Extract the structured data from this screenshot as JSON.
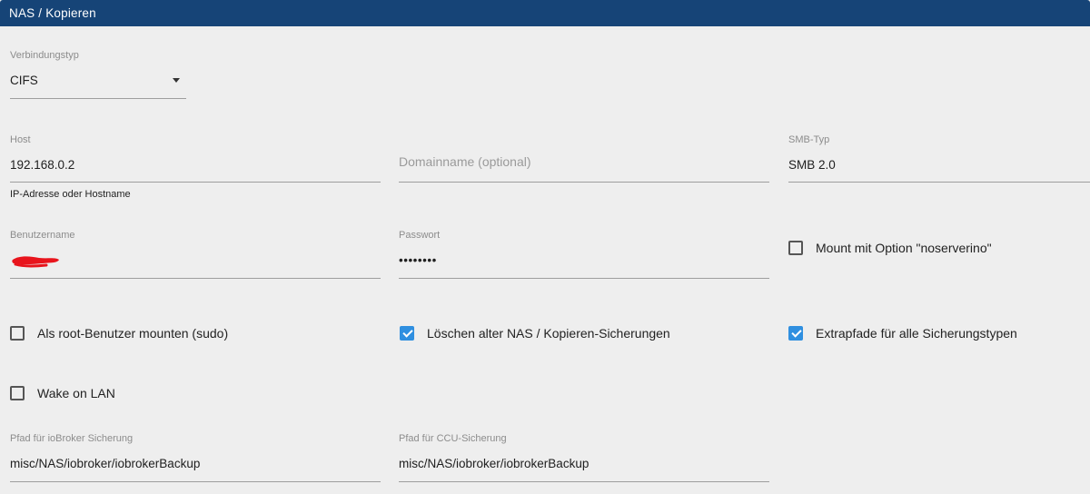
{
  "header": {
    "title": "NAS / Kopieren"
  },
  "connection_type": {
    "label": "Verbindungstyp",
    "value": "CIFS"
  },
  "host": {
    "label": "Host",
    "value": "192.168.0.2",
    "helper": "IP-Adresse oder Hostname"
  },
  "domain": {
    "placeholder": "Domainname (optional)"
  },
  "smb_type": {
    "label": "SMB-Typ",
    "value": "SMB 2.0"
  },
  "username": {
    "label": "Benutzername"
  },
  "password": {
    "label": "Passwort",
    "value": "••••••••"
  },
  "checkboxes": {
    "noserverino": {
      "label": "Mount mit Option \"noserverino\"",
      "checked": false
    },
    "sudo": {
      "label": "Als root-Benutzer mounten (sudo)",
      "checked": false
    },
    "delete_old": {
      "label": "Löschen alter NAS / Kopieren-Sicherungen",
      "checked": true
    },
    "extra_paths": {
      "label": "Extrapfade für alle Sicherungstypen",
      "checked": true
    },
    "wake_on_lan": {
      "label": "Wake on LAN",
      "checked": false
    }
  },
  "iobroker_path": {
    "label": "Pfad für ioBroker Sicherung",
    "value": "misc/NAS/iobroker/iobrokerBackup"
  },
  "ccu_path": {
    "label": "Pfad für CCU-Sicherung",
    "value": "misc/NAS/iobroker/iobrokerBackup"
  },
  "colors": {
    "header": "#164477",
    "checkbox_checked": "#2f8fe0",
    "redaction": "#e8141c"
  }
}
